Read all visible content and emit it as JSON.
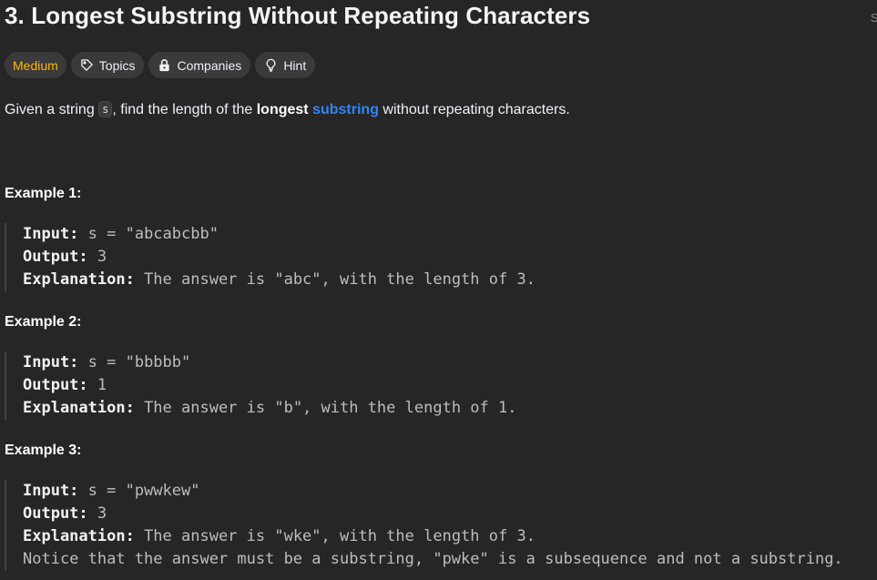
{
  "problem": {
    "title": "3. Longest Substring Without Repeating Characters",
    "edge_text": "S"
  },
  "tags": {
    "difficulty": "Medium",
    "topics": "Topics",
    "companies": "Companies",
    "hint": "Hint",
    "colors": {
      "medium": "#ffb800",
      "pill_bg": "#3a3a3a"
    }
  },
  "description": {
    "pre": "Given a string ",
    "var": "s",
    "mid": ", find the length of the ",
    "bold": "longest",
    "space": " ",
    "link": "substring",
    "post": " without repeating characters.",
    "link_color": "#2f86f6"
  },
  "labels": {
    "input": "Input:",
    "output": "Output:",
    "explanation": "Explanation:"
  },
  "examples": [
    {
      "heading": "Example 1:",
      "input": " s = \"abcabcbb\"",
      "output": " 3",
      "explanation": " The answer is \"abc\", with the length of 3.",
      "note": ""
    },
    {
      "heading": "Example 2:",
      "input": " s = \"bbbbb\"",
      "output": " 1",
      "explanation": " The answer is \"b\", with the length of 1.",
      "note": ""
    },
    {
      "heading": "Example 3:",
      "input": " s = \"pwwkew\"",
      "output": " 3",
      "explanation": " The answer is \"wke\", with the length of 3.",
      "note": "Notice that the answer must be a substring, \"pwke\" is a subsequence and not a substring."
    }
  ]
}
